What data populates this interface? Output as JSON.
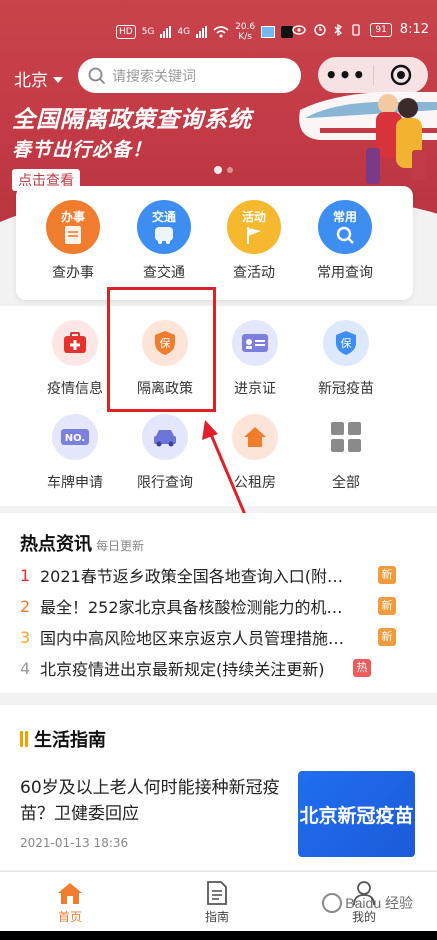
{
  "status_bar": {
    "hd": "HD",
    "net1": "5G",
    "net2": "4G",
    "speed_value": "20.6",
    "speed_unit": "K/s",
    "battery": "91",
    "time": "8:12"
  },
  "header": {
    "city": "北京",
    "search_placeholder": "请搜索关键词",
    "capsule_more": "•••"
  },
  "banner": {
    "title": "全国隔离政策查询系统",
    "subtitle": "春节出行必备！",
    "cta": "点击查看"
  },
  "quick_entries": [
    {
      "tag": "办事",
      "label": "查办事",
      "color": "#f07c2e"
    },
    {
      "tag": "交通",
      "label": "查交通",
      "color": "#3d8ef0"
    },
    {
      "tag": "活动",
      "label": "查活动",
      "color": "#f5b82e"
    },
    {
      "tag": "常用",
      "label": "常用查询",
      "color": "#3d8ef0"
    }
  ],
  "services": [
    {
      "label": "疫情信息",
      "icon": "medical-kit-icon"
    },
    {
      "label": "隔离政策",
      "icon": "shield-icon",
      "glyph": "保"
    },
    {
      "label": "进京证",
      "icon": "id-card-icon"
    },
    {
      "label": "新冠疫苗",
      "icon": "shield-icon",
      "glyph": "保"
    },
    {
      "label": "车牌申请",
      "icon": "license-plate-icon",
      "glyph": "NO."
    },
    {
      "label": "限行查询",
      "icon": "car-icon"
    },
    {
      "label": "公租房",
      "icon": "house-icon"
    },
    {
      "label": "全部",
      "icon": "grid-icon"
    }
  ],
  "hot_news": {
    "title": "热点资讯",
    "subtitle": "每日更新",
    "items": [
      {
        "rank": "1",
        "text": "2021春节返乡政策全国各地查询入口(附…",
        "badge": "新",
        "rank_color": "#e5322d",
        "badge_color": "#f39a3d"
      },
      {
        "rank": "2",
        "text": "最全！252家北京具备核酸检测能力的机…",
        "badge": "新",
        "rank_color": "#f07c2e",
        "badge_color": "#f39a3d"
      },
      {
        "rank": "3",
        "text": "国内中高风险地区来京返京人员管理措施…",
        "badge": "新",
        "rank_color": "#f5a623",
        "badge_color": "#f39a3d"
      },
      {
        "rank": "4",
        "text": "北京疫情进出京最新规定(持续关注更新)",
        "badge": "热",
        "rank_color": "#999999",
        "badge_color": "#f05a5a"
      }
    ]
  },
  "life_guide": {
    "title": "生活指南",
    "article_title": "60岁及以上老人何时能接种新冠疫苗？卫健委回应",
    "article_date": "2021-01-13 18:36",
    "thumb_text": "北京新冠疫苗"
  },
  "tabbar": {
    "tabs": [
      {
        "label": "首页",
        "active": true
      },
      {
        "label": "指南",
        "active": false
      },
      {
        "label": "我的",
        "active": false
      }
    ],
    "active_color": "#f07c2e"
  },
  "watermark": "Baidu 经验"
}
